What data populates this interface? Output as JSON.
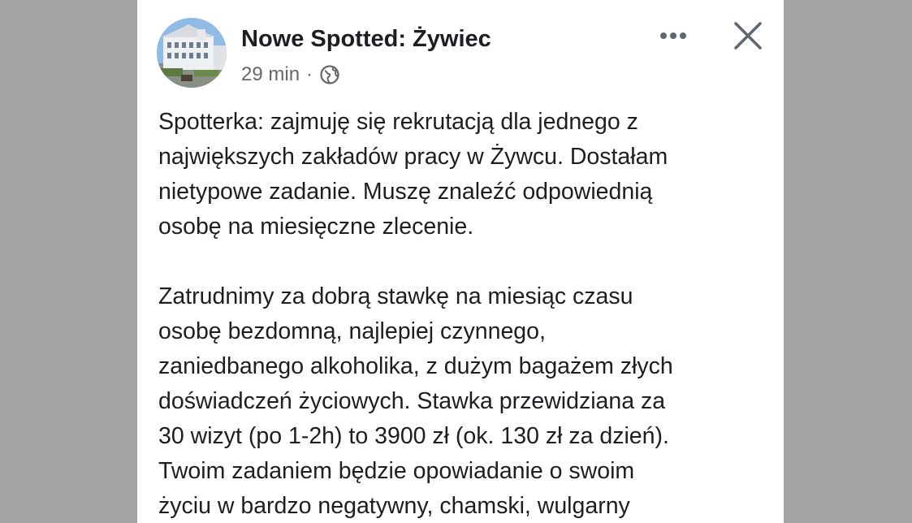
{
  "post": {
    "page_name": "Nowe Spotted: Żywiec",
    "time": "29 min",
    "separator": "·",
    "privacy_icon": "globe-icon",
    "avatar_icon": "building-photo",
    "paragraphs": [
      [
        "Spotterka: zajmuję się rekrutacją dla jednego z",
        "największych zakładów pracy w Żywcu. Dostałam",
        "nietypowe zadanie. Muszę znaleźć odpowiednią",
        "osobę na miesięczne zlecenie."
      ],
      [
        "Zatrudnimy za dobrą stawkę na miesiąc czasu",
        "osobę bezdomną, najlepiej czynnego,",
        "zaniedbanego alkoholika, z dużym bagażem złych",
        "doświadczeń życiowych. Stawka przewidziana za",
        "30 wizyt (po 1-2h) to 3900 zł (ok. 130 zł za dzień).",
        "Twoim zadaniem będzie opowiadanie o swoim",
        "życiu w bardzo negatywny, chamski, wulgarny"
      ]
    ]
  },
  "actions": {
    "more_icon": "more-dots-icon",
    "close_icon": "close-icon"
  },
  "colors": {
    "backdrop": "#a3a3a3",
    "card": "#ffffff",
    "text_primary": "#1c1e21",
    "text_secondary": "#65676b"
  }
}
